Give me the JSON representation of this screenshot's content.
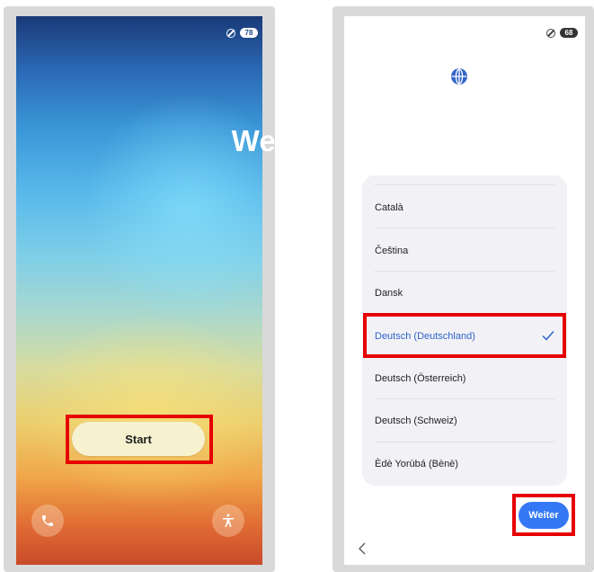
{
  "left_phone": {
    "status": {
      "battery": "78"
    },
    "title": "Welcome",
    "start_label": "Start",
    "icons": {
      "left": "phone-icon",
      "right": "accessibility-icon"
    }
  },
  "right_phone": {
    "status": {
      "battery": "68"
    },
    "header_icon": "globe-icon",
    "languages": [
      {
        "label": "Català",
        "selected": false
      },
      {
        "label": "Čeština",
        "selected": false
      },
      {
        "label": "Dansk",
        "selected": false
      },
      {
        "label": "Deutsch (Deutschland)",
        "selected": true
      },
      {
        "label": "Deutsch (Österreich)",
        "selected": false
      },
      {
        "label": "Deutsch (Schweiz)",
        "selected": false
      },
      {
        "label": "Èdè Yorùbá (Bènè)",
        "selected": false
      }
    ],
    "next_label": "Weiter",
    "back_icon": "back-chevron-icon"
  },
  "colors": {
    "highlight": "#e60000",
    "accent": "#3478f6",
    "selected_text": "#2f63c9"
  }
}
